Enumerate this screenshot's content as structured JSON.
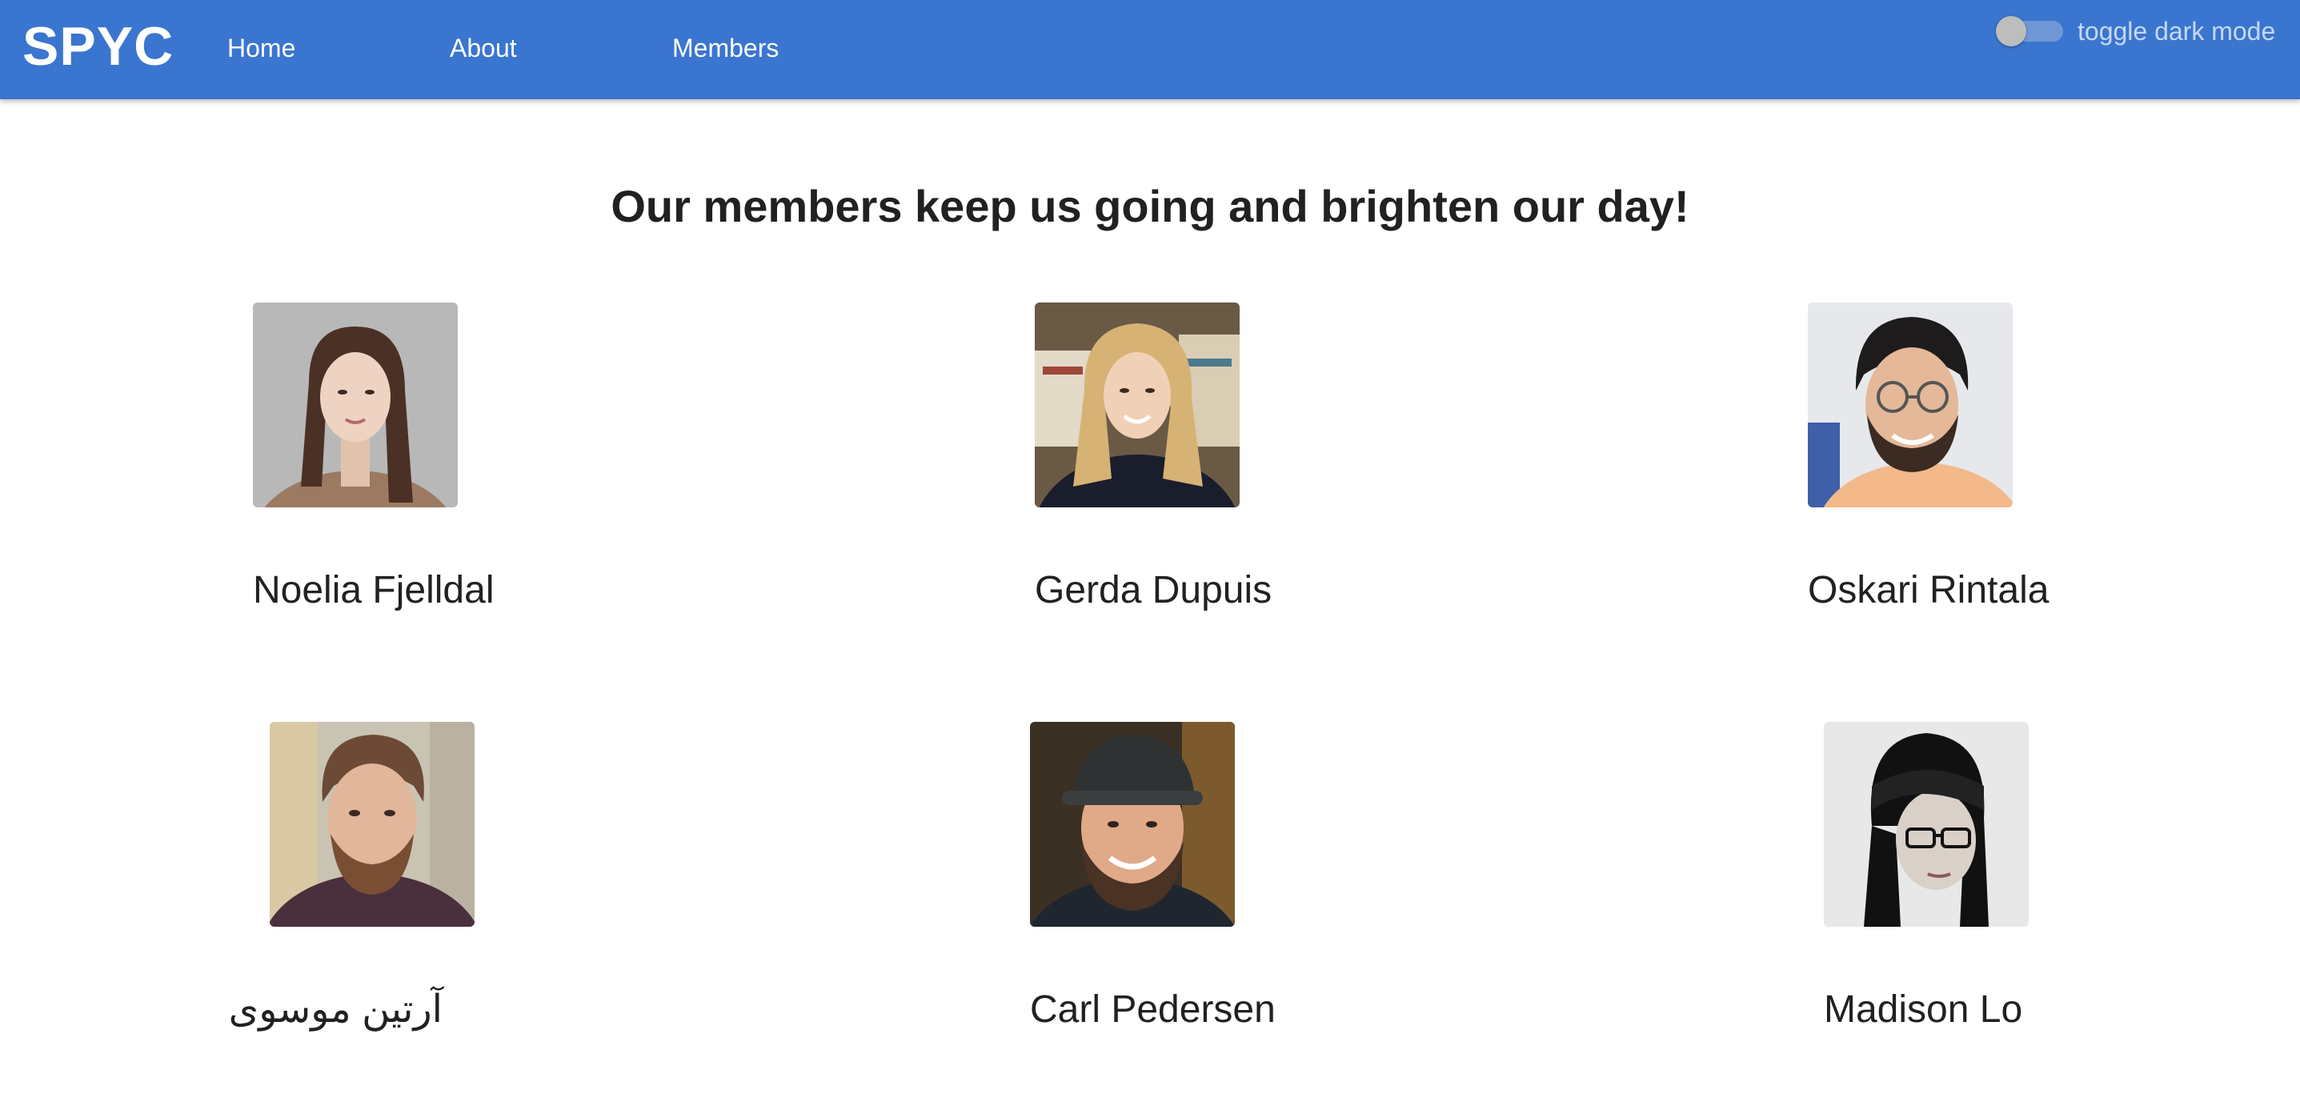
{
  "brand": "SPYC",
  "nav": {
    "home": "Home",
    "about": "About",
    "members": "Members"
  },
  "toggle": {
    "label": "toggle dark mode",
    "checked": false
  },
  "headline": "Our members keep us going and brighten our day!",
  "members": [
    {
      "name": "Noelia Fjelldal"
    },
    {
      "name": "Gerda Dupuis"
    },
    {
      "name": "Oskari Rintala"
    },
    {
      "name": "آرتین موسوی"
    },
    {
      "name": "Carl Pedersen"
    },
    {
      "name": "Madison Lo"
    }
  ],
  "colors": {
    "header": "#3a75cf",
    "text": "#212121",
    "background": "#ffffff"
  }
}
